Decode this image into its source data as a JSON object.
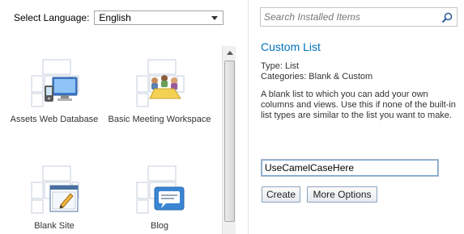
{
  "language": {
    "label": "Select Language:",
    "selected": "English"
  },
  "search": {
    "placeholder": "Search Installed Items"
  },
  "templates": [
    {
      "name": "Assets Web Database",
      "icon": "assets-database-icon"
    },
    {
      "name": "Basic Meeting Workspace",
      "icon": "meeting-workspace-icon"
    },
    {
      "name": "Blank Site",
      "icon": "blank-site-icon"
    },
    {
      "name": "Blog",
      "icon": "blog-icon"
    }
  ],
  "details": {
    "title": "Custom List",
    "type": "Type: List",
    "categories": "Categories: Blank & Custom",
    "description": "A blank list to which you can add your own columns and views. Use this if none of the built-in list types are similar to the list you want to make."
  },
  "name_field": {
    "value": "UseCamelCaseHere"
  },
  "buttons": {
    "create": "Create",
    "more_options": "More Options"
  },
  "colors": {
    "title_blue": "#0072bc",
    "button_border": "#8aa4bd",
    "input_focus": "#7aa7d6"
  }
}
